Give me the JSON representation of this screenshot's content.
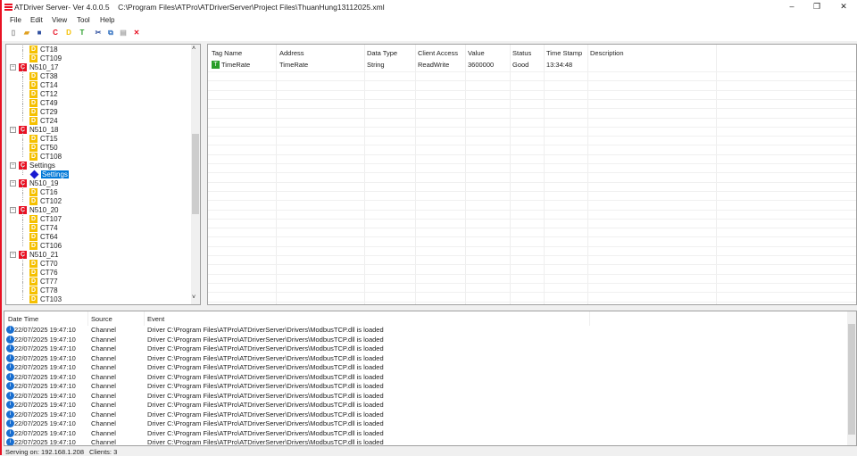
{
  "window": {
    "title": "ATDriver Server- Ver 4.0.0.5",
    "path": "C:\\Program Files\\ATPro\\ATDriverServer\\Project Files\\ThuanHung13112025.xml",
    "minimize": "–",
    "maximize": "❐",
    "close": "✕"
  },
  "menu": [
    "File",
    "Edit",
    "View",
    "Tool",
    "Help"
  ],
  "toolbar": [
    {
      "name": "new-icon",
      "glyph": "▯",
      "color": "#888"
    },
    {
      "name": "open-icon",
      "glyph": "▰",
      "color": "#e0a020"
    },
    {
      "name": "save-icon",
      "glyph": "■",
      "color": "#3050a0"
    },
    {
      "name": "add-channel-icon",
      "glyph": "C",
      "color": "#e81123"
    },
    {
      "name": "add-device-icon",
      "glyph": "D",
      "color": "#f5c000"
    },
    {
      "name": "add-tag-icon",
      "glyph": "T",
      "color": "#2a9d2a"
    },
    {
      "name": "cut-icon",
      "glyph": "✂",
      "color": "#3050a0"
    },
    {
      "name": "copy-icon",
      "glyph": "⧉",
      "color": "#3070c0"
    },
    {
      "name": "paste-icon",
      "glyph": "▤",
      "color": "#aaa"
    },
    {
      "name": "delete-icon",
      "glyph": "✕",
      "color": "#e81123"
    }
  ],
  "tree": [
    {
      "type": "device",
      "label": "CT18"
    },
    {
      "type": "device",
      "label": "CT109"
    },
    {
      "type": "channel",
      "label": "N510_17"
    },
    {
      "type": "device",
      "label": "CT38"
    },
    {
      "type": "device",
      "label": "CT14"
    },
    {
      "type": "device",
      "label": "CT12"
    },
    {
      "type": "device",
      "label": "CT49"
    },
    {
      "type": "device",
      "label": "CT29"
    },
    {
      "type": "device",
      "label": "CT24"
    },
    {
      "type": "channel",
      "label": "N510_18"
    },
    {
      "type": "device",
      "label": "CT15"
    },
    {
      "type": "device",
      "label": "CT50"
    },
    {
      "type": "device",
      "label": "CT108"
    },
    {
      "type": "channel",
      "label": "Settings"
    },
    {
      "type": "settings",
      "label": "Settings",
      "selected": true
    },
    {
      "type": "channel",
      "label": "N510_19"
    },
    {
      "type": "device",
      "label": "CT16"
    },
    {
      "type": "device",
      "label": "CT102"
    },
    {
      "type": "channel",
      "label": "N510_20"
    },
    {
      "type": "device",
      "label": "CT107"
    },
    {
      "type": "device",
      "label": "CT74"
    },
    {
      "type": "device",
      "label": "CT64"
    },
    {
      "type": "device",
      "label": "CT106"
    },
    {
      "type": "channel",
      "label": "N510_21"
    },
    {
      "type": "device",
      "label": "CT70"
    },
    {
      "type": "device",
      "label": "CT76"
    },
    {
      "type": "device",
      "label": "CT77"
    },
    {
      "type": "device",
      "label": "CT78"
    },
    {
      "type": "device",
      "label": "CT103"
    }
  ],
  "tags": {
    "columns": [
      "Tag Name",
      "Address",
      "Data Type",
      "Client Access",
      "Value",
      "Status",
      "Time Stamp",
      "Description"
    ],
    "rows": [
      [
        "TimeRate",
        "TimeRate",
        "String",
        "ReadWrite",
        "3600000",
        "Good",
        "13:34:48",
        ""
      ]
    ]
  },
  "log": {
    "columns": [
      "Date Time",
      "Source",
      "Event"
    ],
    "rows": [
      [
        "22/07/2025 19:47:10",
        "Channel",
        "Driver C:\\Program Files\\ATPro\\ATDriverServer\\Drivers\\ModbusTCP.dll is loaded"
      ],
      [
        "22/07/2025 19:47:10",
        "Channel",
        "Driver C:\\Program Files\\ATPro\\ATDriverServer\\Drivers\\ModbusTCP.dll is loaded"
      ],
      [
        "22/07/2025 19:47:10",
        "Channel",
        "Driver C:\\Program Files\\ATPro\\ATDriverServer\\Drivers\\ModbusTCP.dll is loaded"
      ],
      [
        "22/07/2025 19:47:10",
        "Channel",
        "Driver C:\\Program Files\\ATPro\\ATDriverServer\\Drivers\\ModbusTCP.dll is loaded"
      ],
      [
        "22/07/2025 19:47:10",
        "Channel",
        "Driver C:\\Program Files\\ATPro\\ATDriverServer\\Drivers\\ModbusTCP.dll is loaded"
      ],
      [
        "22/07/2025 19:47:10",
        "Channel",
        "Driver C:\\Program Files\\ATPro\\ATDriverServer\\Drivers\\ModbusTCP.dll is loaded"
      ],
      [
        "22/07/2025 19:47:10",
        "Channel",
        "Driver C:\\Program Files\\ATPro\\ATDriverServer\\Drivers\\ModbusTCP.dll is loaded"
      ],
      [
        "22/07/2025 19:47:10",
        "Channel",
        "Driver C:\\Program Files\\ATPro\\ATDriverServer\\Drivers\\ModbusTCP.dll is loaded"
      ],
      [
        "22/07/2025 19:47:10",
        "Channel",
        "Driver C:\\Program Files\\ATPro\\ATDriverServer\\Drivers\\ModbusTCP.dll is loaded"
      ],
      [
        "22/07/2025 19:47:10",
        "Channel",
        "Driver C:\\Program Files\\ATPro\\ATDriverServer\\Drivers\\ModbusTCP.dll is loaded"
      ],
      [
        "22/07/2025 19:47:10",
        "Channel",
        "Driver C:\\Program Files\\ATPro\\ATDriverServer\\Drivers\\ModbusTCP.dll is loaded"
      ],
      [
        "22/07/2025 19:47:10",
        "Channel",
        "Driver C:\\Program Files\\ATPro\\ATDriverServer\\Drivers\\ModbusTCP.dll is loaded"
      ],
      [
        "22/07/2025 19:47:10",
        "Channel",
        "Driver C:\\Program Files\\ATPro\\ATDriverServer\\Drivers\\ModbusTCP.dll is loaded"
      ]
    ]
  },
  "status": {
    "serving": "Serving on: 192.168.1.208",
    "clients": "Clients: 3"
  }
}
